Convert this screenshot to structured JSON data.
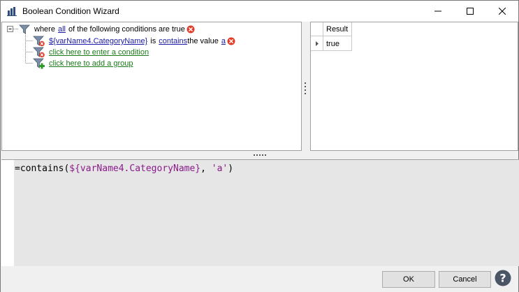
{
  "window": {
    "title": "Boolean Condition Wizard",
    "app_icon": "bar-chart-icon",
    "controls": [
      "minimize-icon",
      "maximize-icon",
      "close-icon"
    ]
  },
  "tree": {
    "root": {
      "prefix": "where",
      "quantifier": "all",
      "suffix": "of the following conditions are true"
    },
    "condition": {
      "field": "${varName4.CategoryName}",
      "is": "is",
      "operator": "contains",
      "value_label": "the value",
      "value": "a"
    },
    "add_condition": "click here to enter a condition",
    "add_group": "click here to add a group"
  },
  "result": {
    "header": "Result",
    "value": "true"
  },
  "editor": {
    "fn_open": "=contains(",
    "var": "${varName4.CategoryName}",
    "sep": ", ",
    "str": "'a'",
    "fn_close": ")"
  },
  "footer": {
    "ok_label": "OK",
    "cancel_label": "Cancel",
    "help_icon": "help-icon"
  },
  "colors": {
    "link_blue": "#1a1aa6",
    "link_green": "#1a7a1a",
    "delete_red": "#e03c28",
    "expr_purple": "#8a1a8a"
  }
}
